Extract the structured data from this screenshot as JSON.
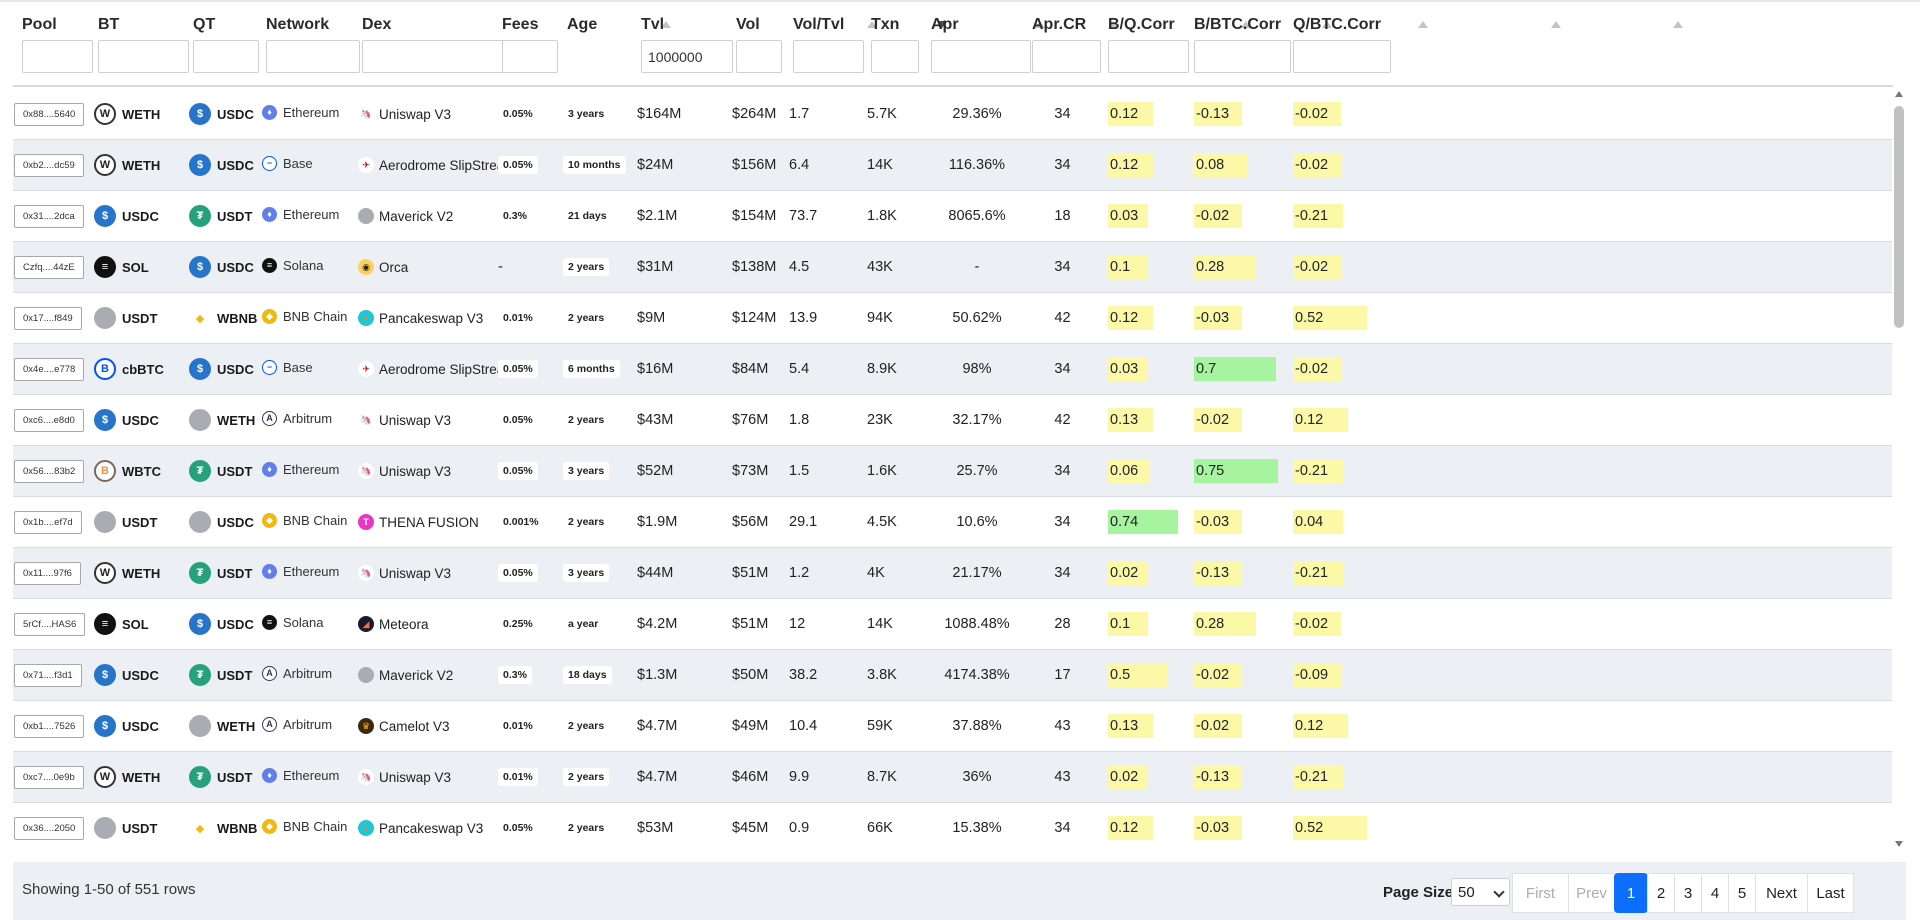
{
  "columns": [
    {
      "key": "pool",
      "label": "Pool",
      "sort": "",
      "filter": ""
    },
    {
      "key": "bt",
      "label": "BT",
      "sort": "",
      "filter": ""
    },
    {
      "key": "qt",
      "label": "QT",
      "sort": "",
      "filter": ""
    },
    {
      "key": "network",
      "label": "Network",
      "sort": "",
      "filter": ""
    },
    {
      "key": "dex",
      "label": "Dex",
      "sort": "",
      "filter": ""
    },
    {
      "key": "fees",
      "label": "Fees",
      "sort": "up",
      "filter": ""
    },
    {
      "key": "age",
      "label": "Age",
      "sort": "",
      "filter": ""
    },
    {
      "key": "tvl",
      "label": "Tvl",
      "sort": "up",
      "filter": "1000000"
    },
    {
      "key": "vol",
      "label": "Vol",
      "sort": "down",
      "filter": ""
    },
    {
      "key": "voltvl",
      "label": "Vol/Tvl",
      "sort": "up",
      "filter": ""
    },
    {
      "key": "txn",
      "label": "Txn",
      "sort": "up",
      "filter": ""
    },
    {
      "key": "apr",
      "label": "Apr",
      "sort": "up",
      "filter": ""
    },
    {
      "key": "aprcr",
      "label": "Apr.CR",
      "sort": "up",
      "filter": ""
    },
    {
      "key": "bq",
      "label": "B/Q.Corr",
      "sort": "up",
      "filter": ""
    },
    {
      "key": "bbtc",
      "label": "B/BTC.Corr",
      "sort": "up",
      "filter": ""
    },
    {
      "key": "qbtc",
      "label": "Q/BTC.Corr",
      "sort": "up",
      "filter": ""
    }
  ],
  "colors": {
    "corr_yellow": "#fbf9a8",
    "corr_green": "#a6f3a0",
    "pager_active": "#0d6efd",
    "row_alt": "#eceff3"
  },
  "token_icons": {
    "WETH": {
      "icon": "weth-icon",
      "bg": "#ffffff",
      "fg": "#222",
      "glyph": "W",
      "border": "#333"
    },
    "USDC": {
      "icon": "usdc-icon",
      "bg": "#2775ca",
      "fg": "#fff",
      "glyph": "$",
      "border": "#2775ca"
    },
    "USDT": {
      "icon": "usdt-icon",
      "bg": "#26a17b",
      "fg": "#fff",
      "glyph": "₮",
      "border": "#26a17b"
    },
    "USDT_GRAY": {
      "icon": "token-placeholder-icon",
      "bg": "#a9acb2",
      "fg": "#a9acb2",
      "glyph": "",
      "border": "#a9acb2"
    },
    "WETH_GRAY": {
      "icon": "token-placeholder-icon",
      "bg": "#a9acb2",
      "fg": "#a9acb2",
      "glyph": "",
      "border": "#a9acb2"
    },
    "USDC_GRAY": {
      "icon": "token-placeholder-icon",
      "bg": "#a9acb2",
      "fg": "#a9acb2",
      "glyph": "",
      "border": "#a9acb2"
    },
    "SOL": {
      "icon": "sol-icon",
      "bg": "#111111",
      "fg": "#fff",
      "glyph": "≡",
      "border": "#111"
    },
    "WBNB": {
      "icon": "wbnb-icon",
      "bg": "#ffffff",
      "fg": "#f0b90b",
      "glyph": "◆",
      "border": "#ffffff"
    },
    "cbBTC": {
      "icon": "cbbtc-icon",
      "bg": "#ffffff",
      "fg": "#0052ff",
      "glyph": "B",
      "border": "#0052ff"
    },
    "WBTC": {
      "icon": "wbtc-icon",
      "bg": "#ffffff",
      "fg": "#f09242",
      "glyph": "B",
      "border": "#7a6a5a"
    }
  },
  "network_icons": {
    "Ethereum": {
      "icon": "ethereum-icon",
      "bg": "#627eea",
      "glyph": "♦"
    },
    "Base": {
      "icon": "base-icon",
      "bg": "#ffffff",
      "glyph": "−",
      "border": "#0052ff"
    },
    "Solana": {
      "icon": "solana-icon",
      "bg": "#111111",
      "glyph": "≡"
    },
    "BNB Chain": {
      "icon": "bnb-chain-icon",
      "bg": "#f0b90b",
      "glyph": "◆"
    },
    "Arbitrum": {
      "icon": "arbitrum-icon",
      "bg": "#ffffff",
      "glyph": "A",
      "border": "#2d374b"
    }
  },
  "dex_icons": {
    "Uniswap V3": {
      "icon": "uniswap-icon",
      "bg": "#ffffff",
      "glyph": "🦄",
      "fg": "#ff007a"
    },
    "Aerodrome SlipStream": {
      "icon": "aerodrome-icon",
      "bg": "#ffffff",
      "glyph": "✈",
      "fg": "#d00"
    },
    "Maverick V2": {
      "icon": "maverick-icon",
      "bg": "#a9acb2",
      "glyph": "",
      "fg": "#a9acb2"
    },
    "Orca": {
      "icon": "orca-icon",
      "bg": "#ffd15c",
      "glyph": "◉",
      "fg": "#222"
    },
    "Pancakeswap V3": {
      "icon": "pancakeswap-icon",
      "bg": "#1fc7d4",
      "glyph": "●",
      "fg": "#d1884f"
    },
    "THENA FUSION": {
      "icon": "thena-icon",
      "bg": "#e935c2",
      "glyph": "T",
      "fg": "#fff"
    },
    "Meteora": {
      "icon": "meteora-icon",
      "bg": "#1a1a2e",
      "glyph": "◢",
      "fg": "#ff6b3d"
    },
    "Camelot V3": {
      "icon": "camelot-icon",
      "bg": "#3b2a0e",
      "glyph": "♛",
      "fg": "#ffaf1d"
    }
  },
  "rows": [
    {
      "pool": "0x88....5640",
      "bt": "WETH",
      "bt_icon": "WETH",
      "qt": "USDC",
      "qt_icon": "USDC",
      "network": "Ethereum",
      "dex": "Uniswap V3",
      "fees": "0.05%",
      "age": "3 years",
      "tvl": "$164M",
      "vol": "$264M",
      "voltvl": "1.7",
      "txn": "5.7K",
      "apr": "29.36%",
      "aprcr": "34",
      "bq": {
        "v": "0.12",
        "c": "yellow",
        "w": 45
      },
      "bbtc": {
        "v": "-0.13",
        "c": "yellow",
        "w": 48
      },
      "qbtc": {
        "v": "-0.02",
        "c": "yellow",
        "w": 48
      }
    },
    {
      "pool": "0xb2....dc59",
      "bt": "WETH",
      "bt_icon": "WETH",
      "qt": "USDC",
      "qt_icon": "USDC",
      "network": "Base",
      "dex": "Aerodrome SlipStream",
      "fees": "0.05%",
      "age": "10 months",
      "tvl": "$24M",
      "vol": "$156M",
      "voltvl": "6.4",
      "txn": "14K",
      "apr": "116.36%",
      "aprcr": "34",
      "bq": {
        "v": "0.12",
        "c": "yellow",
        "w": 45
      },
      "bbtc": {
        "v": "0.08",
        "c": "yellow",
        "w": 53
      },
      "qbtc": {
        "v": "-0.02",
        "c": "yellow",
        "w": 48
      }
    },
    {
      "pool": "0x31....2dca",
      "bt": "USDC",
      "bt_icon": "USDC",
      "qt": "USDT",
      "qt_icon": "USDT",
      "network": "Ethereum",
      "dex": "Maverick V2",
      "fees": "0.3%",
      "age": "21 days",
      "tvl": "$2.1M",
      "vol": "$154M",
      "voltvl": "73.7",
      "txn": "1.8K",
      "apr": "8065.6%",
      "aprcr": "18",
      "bq": {
        "v": "0.03",
        "c": "yellow",
        "w": 40
      },
      "bbtc": {
        "v": "-0.02",
        "c": "yellow",
        "w": 48
      },
      "qbtc": {
        "v": "-0.21",
        "c": "yellow",
        "w": 50
      }
    },
    {
      "pool": "Czfq....44zE",
      "bt": "SOL",
      "bt_icon": "SOL",
      "qt": "USDC",
      "qt_icon": "USDC",
      "network": "Solana",
      "dex": "Orca",
      "fees": "-",
      "age": "2 years",
      "tvl": "$31M",
      "vol": "$138M",
      "voltvl": "4.5",
      "txn": "43K",
      "apr": "-",
      "aprcr": "34",
      "bq": {
        "v": "0.1",
        "c": "yellow",
        "w": 40
      },
      "bbtc": {
        "v": "0.28",
        "c": "yellow",
        "w": 62
      },
      "qbtc": {
        "v": "-0.02",
        "c": "yellow",
        "w": 48
      }
    },
    {
      "pool": "0x17....f849",
      "bt": "USDT",
      "bt_icon": "USDT_GRAY",
      "qt": "WBNB",
      "qt_icon": "WBNB",
      "network": "BNB Chain",
      "dex": "Pancakeswap V3",
      "fees": "0.01%",
      "age": "2 years",
      "tvl": "$9M",
      "vol": "$124M",
      "voltvl": "13.9",
      "txn": "94K",
      "apr": "50.62%",
      "aprcr": "42",
      "bq": {
        "v": "0.12",
        "c": "yellow",
        "w": 45
      },
      "bbtc": {
        "v": "-0.03",
        "c": "yellow",
        "w": 48
      },
      "qbtc": {
        "v": "0.52",
        "c": "yellow",
        "w": 74
      }
    },
    {
      "pool": "0x4e....e778",
      "bt": "cbBTC",
      "bt_icon": "cbBTC",
      "qt": "USDC",
      "qt_icon": "USDC",
      "network": "Base",
      "dex": "Aerodrome SlipStream",
      "fees": "0.05%",
      "age": "6 months",
      "tvl": "$16M",
      "vol": "$84M",
      "voltvl": "5.4",
      "txn": "8.9K",
      "apr": "98%",
      "aprcr": "34",
      "bq": {
        "v": "0.03",
        "c": "yellow",
        "w": 40
      },
      "bbtc": {
        "v": "0.7",
        "c": "green",
        "w": 82
      },
      "qbtc": {
        "v": "-0.02",
        "c": "yellow",
        "w": 48
      }
    },
    {
      "pool": "0xc6....e8d0",
      "bt": "USDC",
      "bt_icon": "USDC",
      "qt": "WETH",
      "qt_icon": "WETH_GRAY",
      "network": "Arbitrum",
      "dex": "Uniswap V3",
      "fees": "0.05%",
      "age": "2 years",
      "tvl": "$43M",
      "vol": "$76M",
      "voltvl": "1.8",
      "txn": "23K",
      "apr": "32.17%",
      "aprcr": "42",
      "bq": {
        "v": "0.13",
        "c": "yellow",
        "w": 45
      },
      "bbtc": {
        "v": "-0.02",
        "c": "yellow",
        "w": 48
      },
      "qbtc": {
        "v": "0.12",
        "c": "yellow",
        "w": 55
      }
    },
    {
      "pool": "0x56....83b2",
      "bt": "WBTC",
      "bt_icon": "WBTC",
      "qt": "USDT",
      "qt_icon": "USDT",
      "network": "Ethereum",
      "dex": "Uniswap V3",
      "fees": "0.05%",
      "age": "3 years",
      "tvl": "$52M",
      "vol": "$73M",
      "voltvl": "1.5",
      "txn": "1.6K",
      "apr": "25.7%",
      "aprcr": "34",
      "bq": {
        "v": "0.06",
        "c": "yellow",
        "w": 42
      },
      "bbtc": {
        "v": "0.75",
        "c": "green",
        "w": 84
      },
      "qbtc": {
        "v": "-0.21",
        "c": "yellow",
        "w": 50
      }
    },
    {
      "pool": "0x1b....ef7d",
      "bt": "USDT",
      "bt_icon": "USDT_GRAY",
      "qt": "USDC",
      "qt_icon": "USDC_GRAY",
      "network": "BNB Chain",
      "dex": "THENA FUSION",
      "fees": "0.001%",
      "age": "2 years",
      "tvl": "$1.9M",
      "vol": "$56M",
      "voltvl": "29.1",
      "txn": "4.5K",
      "apr": "10.6%",
      "aprcr": "34",
      "bq": {
        "v": "0.74",
        "c": "green",
        "w": 70
      },
      "bbtc": {
        "v": "-0.03",
        "c": "yellow",
        "w": 48
      },
      "qbtc": {
        "v": "0.04",
        "c": "yellow",
        "w": 50
      }
    },
    {
      "pool": "0x11....97f6",
      "bt": "WETH",
      "bt_icon": "WETH",
      "qt": "USDT",
      "qt_icon": "USDT",
      "network": "Ethereum",
      "dex": "Uniswap V3",
      "fees": "0.05%",
      "age": "3 years",
      "tvl": "$44M",
      "vol": "$51M",
      "voltvl": "1.2",
      "txn": "4K",
      "apr": "21.17%",
      "aprcr": "34",
      "bq": {
        "v": "0.02",
        "c": "yellow",
        "w": 40
      },
      "bbtc": {
        "v": "-0.13",
        "c": "yellow",
        "w": 48
      },
      "qbtc": {
        "v": "-0.21",
        "c": "yellow",
        "w": 50
      }
    },
    {
      "pool": "5rCf....HAS6",
      "bt": "SOL",
      "bt_icon": "SOL",
      "qt": "USDC",
      "qt_icon": "USDC",
      "network": "Solana",
      "dex": "Meteora",
      "fees": "0.25%",
      "age": "a year",
      "tvl": "$4.2M",
      "vol": "$51M",
      "voltvl": "12",
      "txn": "14K",
      "apr": "1088.48%",
      "aprcr": "28",
      "bq": {
        "v": "0.1",
        "c": "yellow",
        "w": 40
      },
      "bbtc": {
        "v": "0.28",
        "c": "yellow",
        "w": 62
      },
      "qbtc": {
        "v": "-0.02",
        "c": "yellow",
        "w": 48
      }
    },
    {
      "pool": "0x71....f3d1",
      "bt": "USDC",
      "bt_icon": "USDC",
      "qt": "USDT",
      "qt_icon": "USDT",
      "network": "Arbitrum",
      "dex": "Maverick V2",
      "fees": "0.3%",
      "age": "18 days",
      "tvl": "$1.3M",
      "vol": "$50M",
      "voltvl": "38.2",
      "txn": "3.8K",
      "apr": "4174.38%",
      "aprcr": "17",
      "bq": {
        "v": "0.5",
        "c": "yellow",
        "w": 60
      },
      "bbtc": {
        "v": "-0.02",
        "c": "yellow",
        "w": 48
      },
      "qbtc": {
        "v": "-0.09",
        "c": "yellow",
        "w": 48
      }
    },
    {
      "pool": "0xb1....7526",
      "bt": "USDC",
      "bt_icon": "USDC",
      "qt": "WETH",
      "qt_icon": "WETH_GRAY",
      "network": "Arbitrum",
      "dex": "Camelot V3",
      "fees": "0.01%",
      "age": "2 years",
      "tvl": "$4.7M",
      "vol": "$49M",
      "voltvl": "10.4",
      "txn": "59K",
      "apr": "37.88%",
      "aprcr": "43",
      "bq": {
        "v": "0.13",
        "c": "yellow",
        "w": 45
      },
      "bbtc": {
        "v": "-0.02",
        "c": "yellow",
        "w": 48
      },
      "qbtc": {
        "v": "0.12",
        "c": "yellow",
        "w": 55
      }
    },
    {
      "pool": "0xc7....0e9b",
      "bt": "WETH",
      "bt_icon": "WETH",
      "qt": "USDT",
      "qt_icon": "USDT",
      "network": "Ethereum",
      "dex": "Uniswap V3",
      "fees": "0.01%",
      "age": "2 years",
      "tvl": "$4.7M",
      "vol": "$46M",
      "voltvl": "9.9",
      "txn": "8.7K",
      "apr": "36%",
      "aprcr": "43",
      "bq": {
        "v": "0.02",
        "c": "yellow",
        "w": 40
      },
      "bbtc": {
        "v": "-0.13",
        "c": "yellow",
        "w": 48
      },
      "qbtc": {
        "v": "-0.21",
        "c": "yellow",
        "w": 50
      }
    },
    {
      "pool": "0x36....2050",
      "bt": "USDT",
      "bt_icon": "USDT_GRAY",
      "qt": "WBNB",
      "qt_icon": "WBNB",
      "network": "BNB Chain",
      "dex": "Pancakeswap V3",
      "fees": "0.05%",
      "age": "2 years",
      "tvl": "$53M",
      "vol": "$45M",
      "voltvl": "0.9",
      "txn": "66K",
      "apr": "15.38%",
      "aprcr": "34",
      "bq": {
        "v": "0.12",
        "c": "yellow",
        "w": 45
      },
      "bbtc": {
        "v": "-0.03",
        "c": "yellow",
        "w": 48
      },
      "qbtc": {
        "v": "0.52",
        "c": "yellow",
        "w": 74
      }
    }
  ],
  "footer": {
    "showing": "Showing 1-50 of 551 rows",
    "page_size_label": "Page Size",
    "page_size_value": "50",
    "pager": [
      {
        "label": "First",
        "state": "disabled"
      },
      {
        "label": "Prev",
        "state": "disabled"
      },
      {
        "label": "1",
        "state": "active"
      },
      {
        "label": "2",
        "state": ""
      },
      {
        "label": "3",
        "state": ""
      },
      {
        "label": "4",
        "state": ""
      },
      {
        "label": "5",
        "state": ""
      },
      {
        "label": "Next",
        "state": ""
      },
      {
        "label": "Last",
        "state": ""
      }
    ]
  }
}
